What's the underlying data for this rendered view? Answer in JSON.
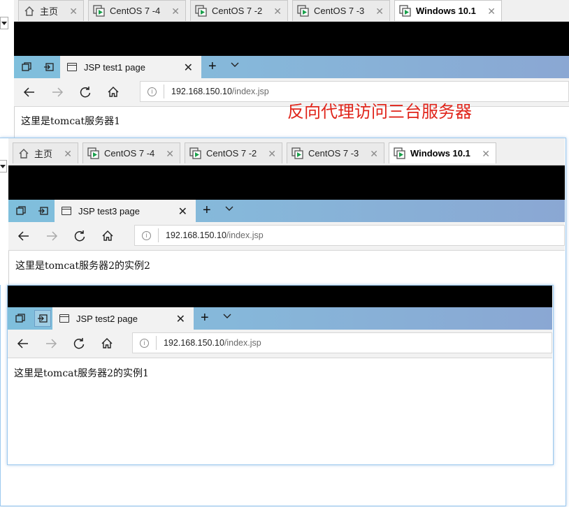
{
  "vm_tabs": [
    {
      "label": "主页",
      "icon": "home-icon",
      "active": false
    },
    {
      "label": "CentOS 7 -4",
      "icon": "vm-icon",
      "active": false
    },
    {
      "label": "CentOS 7 -2",
      "icon": "vm-icon",
      "active": false
    },
    {
      "label": "CentOS 7 -3",
      "icon": "vm-icon",
      "active": false
    },
    {
      "label": "Windows 10.1",
      "icon": "vm-icon",
      "active": true
    }
  ],
  "annotation": "反向代理访问三台服务器",
  "windows": [
    {
      "tab_title": "JSP test1 page",
      "url_host": "192.168.150.10",
      "url_path": "/index.jsp",
      "content": "这里是tomcat服务器1"
    },
    {
      "tab_title": "JSP test3 page",
      "url_host": "192.168.150.10",
      "url_path": "/index.jsp",
      "content": "这里是tomcat服务器2的实例2"
    },
    {
      "tab_title": "JSP test2 page",
      "url_host": "192.168.150.10",
      "url_path": "/index.jsp",
      "content": "这里是tomcat服务器2的实例1"
    }
  ],
  "colors": {
    "annotation": "#e0251b",
    "vm_icon": "#19a04b",
    "tab_gradient_start": "#7fbfdc",
    "tab_gradient_end": "#8aa7d3"
  }
}
